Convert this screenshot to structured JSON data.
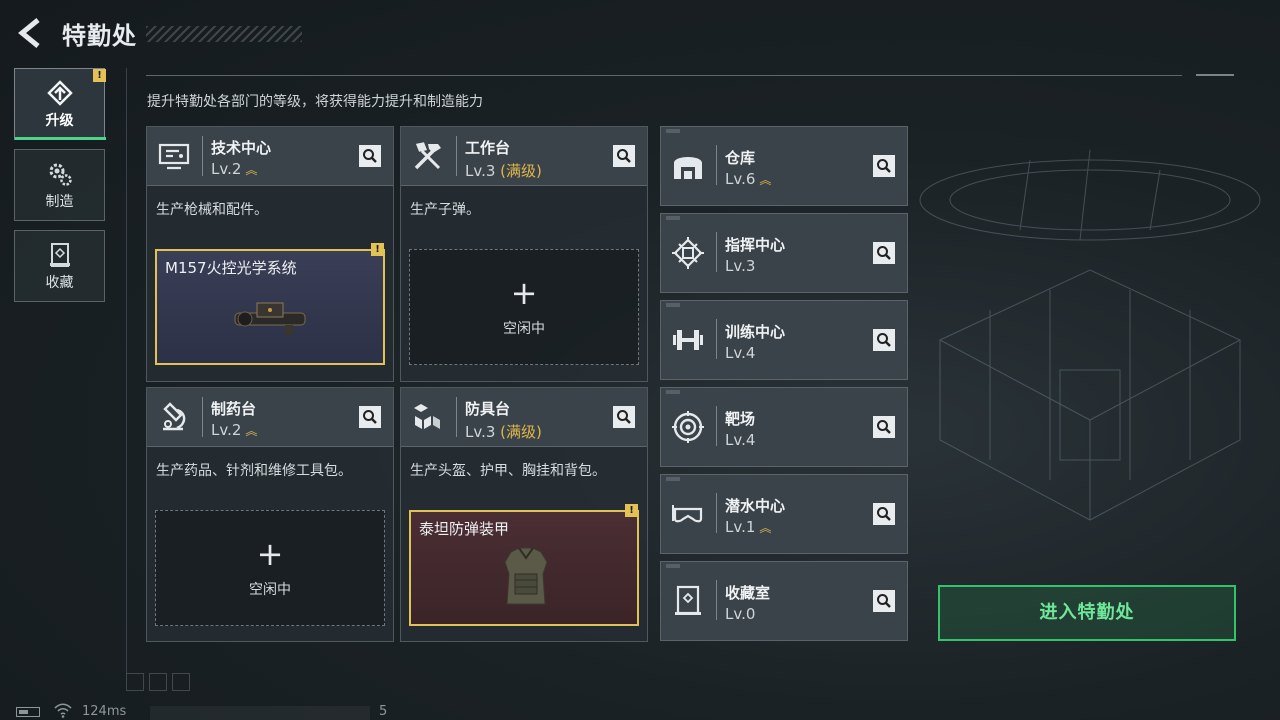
{
  "header": {
    "title": "特勤处"
  },
  "subtitle": "提升特勤处各部门的等级，将获得能力提升和制造能力",
  "sidebar": {
    "items": [
      {
        "label": "升级",
        "icon": "upgrade-icon",
        "active": true,
        "badge": "!"
      },
      {
        "label": "制造",
        "icon": "gears-icon",
        "active": false
      },
      {
        "label": "收藏",
        "icon": "collection-icon",
        "active": false
      }
    ]
  },
  "departments": [
    {
      "name": "技术中心",
      "level": "Lv.2",
      "max_label": "",
      "upgradable": true,
      "icon": "tech-center-icon",
      "desc": "生产枪械和配件。",
      "slot": {
        "state": "filled",
        "item": "M157火控光学系统",
        "badge": "!"
      }
    },
    {
      "name": "工作台",
      "level": "Lv.3",
      "max_label": "(满级)",
      "upgradable": false,
      "icon": "workbench-icon",
      "desc": "生产子弹。",
      "slot": {
        "state": "empty",
        "plus": "+",
        "idle": "空闲中"
      }
    },
    {
      "name": "制药台",
      "level": "Lv.2",
      "max_label": "",
      "upgradable": true,
      "icon": "pharmacy-icon",
      "desc": "生产药品、针剂和维修工具包。",
      "slot": {
        "state": "empty",
        "plus": "+",
        "idle": "空闲中"
      }
    },
    {
      "name": "防具台",
      "level": "Lv.3",
      "max_label": "(满级)",
      "upgradable": false,
      "icon": "armor-bench-icon",
      "desc": "生产头盔、护甲、胸挂和背包。",
      "slot": {
        "state": "filled",
        "item": "泰坦防弹装甲",
        "badge": "!"
      }
    }
  ],
  "rooms": [
    {
      "name": "仓库",
      "level": "Lv.6",
      "upgradable": true,
      "icon": "warehouse-icon"
    },
    {
      "name": "指挥中心",
      "level": "Lv.3",
      "upgradable": false,
      "icon": "command-chip-icon"
    },
    {
      "name": "训练中心",
      "level": "Lv.4",
      "upgradable": false,
      "icon": "dumbbell-icon"
    },
    {
      "name": "靶场",
      "level": "Lv.4",
      "upgradable": false,
      "icon": "target-icon"
    },
    {
      "name": "潜水中心",
      "level": "Lv.1",
      "upgradable": true,
      "icon": "dive-mask-icon"
    },
    {
      "name": "收藏室",
      "level": "Lv.0",
      "upgradable": false,
      "icon": "collection-room-icon"
    }
  ],
  "enter_button": "进入特勤处",
  "status_bar": {
    "ping": "124ms",
    "page": "5"
  },
  "colors": {
    "accent_green": "#36c26c",
    "gold": "#e2c157",
    "maxed_text": "#e0b64b"
  }
}
